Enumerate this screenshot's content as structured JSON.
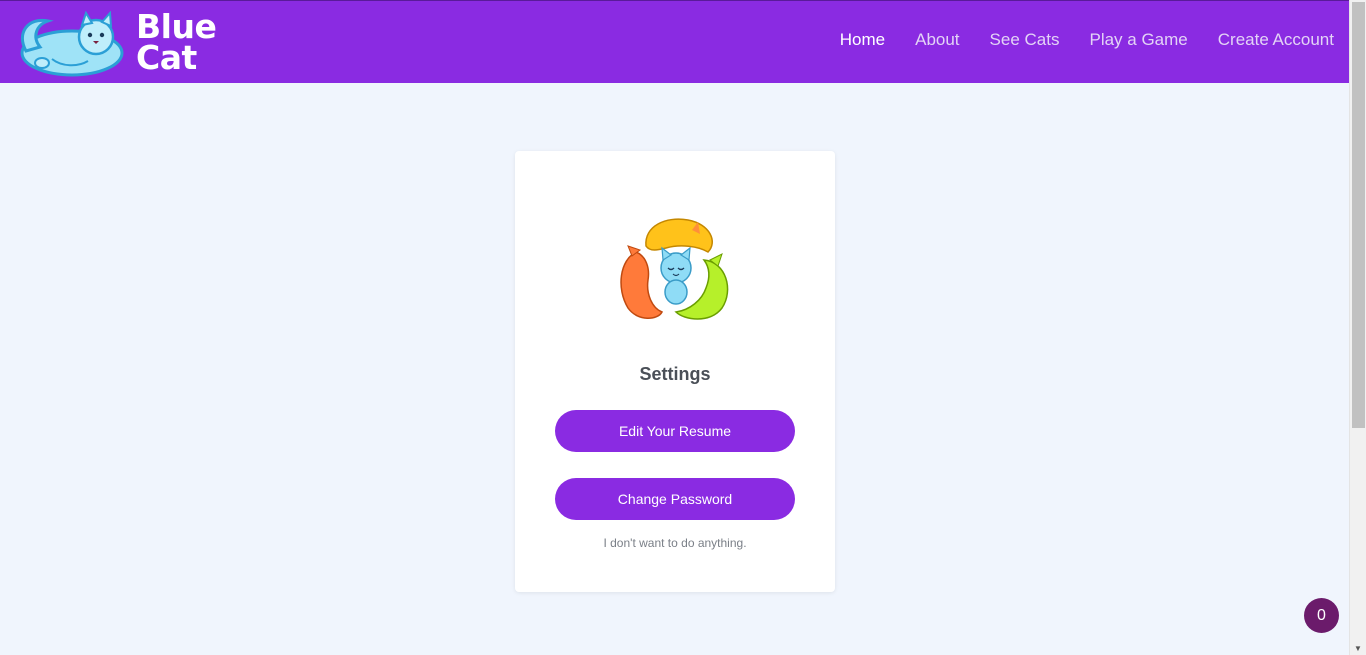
{
  "brand": {
    "line1": "Blue",
    "line2": "Cat"
  },
  "nav": {
    "items": [
      {
        "label": "Home",
        "active": true
      },
      {
        "label": "About"
      },
      {
        "label": "See Cats"
      },
      {
        "label": "Play a Game"
      },
      {
        "label": "Create Account"
      }
    ]
  },
  "card": {
    "title": "Settings",
    "edit_resume_label": "Edit Your Resume",
    "change_password_label": "Change Password",
    "skip_label": "I don't want to do anything."
  },
  "badge": {
    "count": "0"
  },
  "colors": {
    "primary": "#8a2be2",
    "background": "#f0f5fd",
    "badge": "#6b1b6b"
  }
}
